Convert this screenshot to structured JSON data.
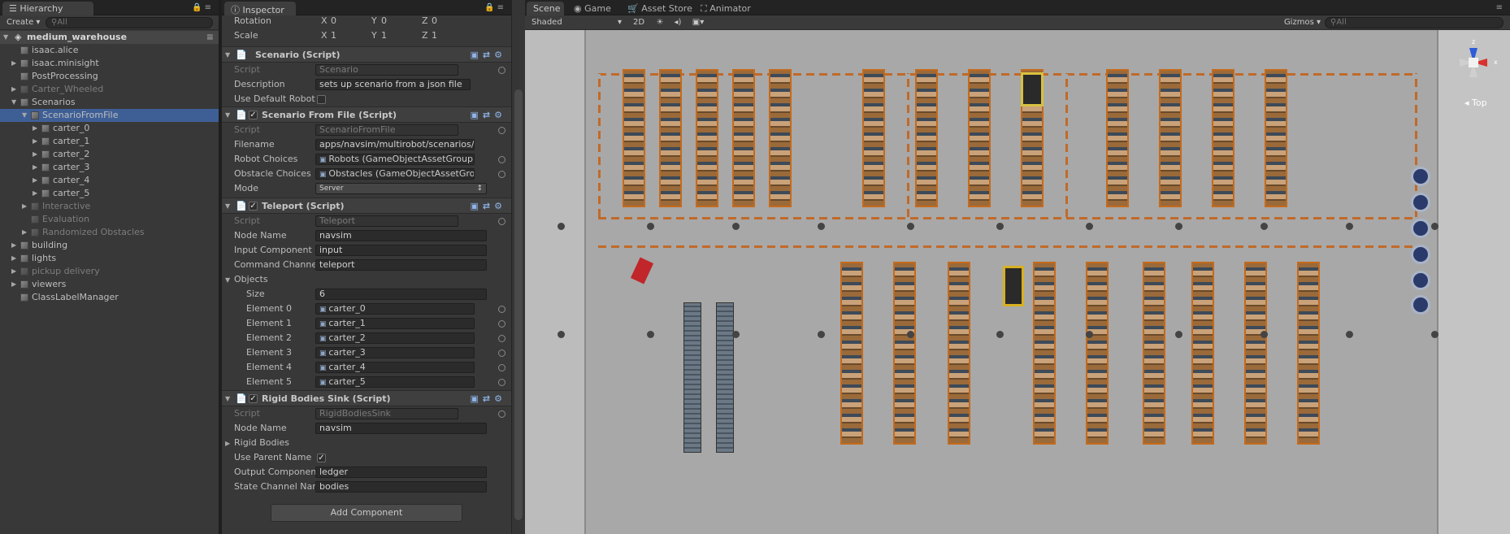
{
  "hierarchy": {
    "tab": "Hierarchy",
    "create_label": "Create",
    "search_placeholder": "All",
    "scene_name": "medium_warehouse",
    "items": [
      {
        "label": "isaac.alice",
        "depth": 1,
        "arrow": false,
        "dim": false
      },
      {
        "label": "isaac.minisight",
        "depth": 1,
        "arrow": true,
        "dim": false
      },
      {
        "label": "PostProcessing",
        "depth": 1,
        "arrow": false,
        "dim": false
      },
      {
        "label": "Carter_Wheeled",
        "depth": 1,
        "arrow": true,
        "dim": true
      },
      {
        "label": "Scenarios",
        "depth": 1,
        "arrow": true,
        "dim": false
      },
      {
        "label": "ScenarioFromFile",
        "depth": 2,
        "arrow": true,
        "dim": false
      },
      {
        "label": "carter_0",
        "depth": 3,
        "arrow": true,
        "dim": false
      },
      {
        "label": "carter_1",
        "depth": 3,
        "arrow": true,
        "dim": false
      },
      {
        "label": "carter_2",
        "depth": 3,
        "arrow": true,
        "dim": false
      },
      {
        "label": "carter_3",
        "depth": 3,
        "arrow": true,
        "dim": false
      },
      {
        "label": "carter_4",
        "depth": 3,
        "arrow": true,
        "dim": false
      },
      {
        "label": "carter_5",
        "depth": 3,
        "arrow": true,
        "dim": false
      },
      {
        "label": "Interactive",
        "depth": 2,
        "arrow": true,
        "dim": true
      },
      {
        "label": "Evaluation",
        "depth": 2,
        "arrow": false,
        "dim": true
      },
      {
        "label": "Randomized Obstacles",
        "depth": 2,
        "arrow": true,
        "dim": true
      },
      {
        "label": "building",
        "depth": 1,
        "arrow": true,
        "dim": false
      },
      {
        "label": "lights",
        "depth": 1,
        "arrow": true,
        "dim": false
      },
      {
        "label": "pickup delivery",
        "depth": 1,
        "arrow": true,
        "dim": true
      },
      {
        "label": "viewers",
        "depth": 1,
        "arrow": true,
        "dim": false
      },
      {
        "label": "ClassLabelManager",
        "depth": 1,
        "arrow": false,
        "dim": false
      }
    ]
  },
  "inspector": {
    "tab": "Inspector",
    "rotation": {
      "label": "Rotation",
      "x": "0",
      "y": "0",
      "z": "0"
    },
    "scale": {
      "label": "Scale",
      "x": "1",
      "y": "1",
      "z": "1"
    },
    "axis_x": "X",
    "axis_y": "Y",
    "axis_z": "Z",
    "scenario": {
      "title": "Scenario (Script)",
      "script_label": "Script",
      "script_value": "Scenario",
      "description_label": "Description",
      "description_value": "sets up scenario from a json file",
      "use_default_robot_label": "Use Default Robot"
    },
    "scenario_from_file": {
      "title": "Scenario From File (Script)",
      "script_label": "Script",
      "script_value": "ScenarioFromFile",
      "filename_label": "Filename",
      "filename_value": "apps/navsim/multirobot/scenarios/mu",
      "robot_choices_label": "Robot Choices",
      "robot_choices_value": "Robots (GameObjectAssetGroup)",
      "obstacle_choices_label": "Obstacle Choices",
      "obstacle_choices_value": "Obstacles (GameObjectAssetGrou",
      "mode_label": "Mode",
      "mode_value": "Server"
    },
    "teleport": {
      "title": "Teleport (Script)",
      "script_label": "Script",
      "script_value": "Teleport",
      "node_name_label": "Node Name",
      "node_name_value": "navsim",
      "input_component_label": "Input Component",
      "input_component_value": "input",
      "command_channel_label": "Command Channel Na",
      "command_channel_value": "teleport",
      "objects_label": "Objects",
      "size_label": "Size",
      "size_value": "6",
      "elements": [
        {
          "label": "Element 0",
          "value": "carter_0"
        },
        {
          "label": "Element 1",
          "value": "carter_1"
        },
        {
          "label": "Element 2",
          "value": "carter_2"
        },
        {
          "label": "Element 3",
          "value": "carter_3"
        },
        {
          "label": "Element 4",
          "value": "carter_4"
        },
        {
          "label": "Element 5",
          "value": "carter_5"
        }
      ]
    },
    "rigid_bodies_sink": {
      "title": "Rigid Bodies Sink (Script)",
      "script_label": "Script",
      "script_value": "RigidBodiesSink",
      "node_name_label": "Node Name",
      "node_name_value": "navsim",
      "rigid_bodies_label": "Rigid Bodies",
      "use_parent_name_label": "Use Parent Name",
      "output_component_label": "Output Component",
      "output_component_value": "ledger",
      "state_channel_label": "State Channel Name",
      "state_channel_value": "bodies"
    },
    "add_component": "Add Component"
  },
  "scene": {
    "tabs": [
      "Scene",
      "Game",
      "Asset Store",
      "Animator"
    ],
    "shading_mode": "Shaded",
    "mode_2d": "2D",
    "gizmos_label": "Gizmos",
    "search_placeholder": "All",
    "view_label": "Top",
    "axis_x": "x",
    "axis_z": "z"
  },
  "colors": {
    "selection": "#3e5f96",
    "panel": "#383838",
    "stripe": "#c06a2a"
  }
}
